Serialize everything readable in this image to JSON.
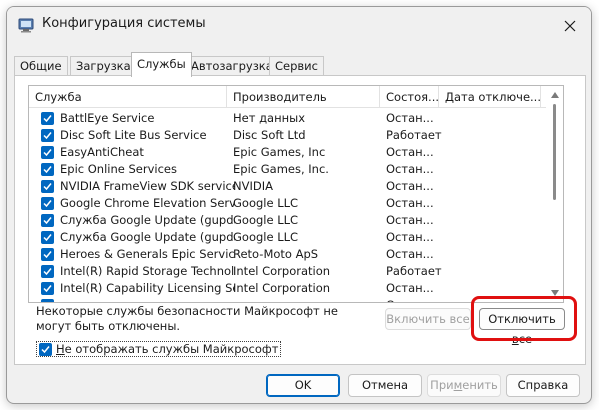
{
  "window": {
    "title": "Конфигурация системы"
  },
  "tabs": [
    {
      "label": "Общие"
    },
    {
      "label": "Загрузка"
    },
    {
      "label": "Службы",
      "active": true
    },
    {
      "label": "Автозагрузка"
    },
    {
      "label": "Сервис"
    }
  ],
  "columns": {
    "service": "Служба",
    "manufacturer": "Производитель",
    "status": "Состоя...",
    "disabled_date": "Дата отключе..."
  },
  "services": [
    {
      "name": "BattlEye Service",
      "manufacturer": "Нет данных",
      "status": "Остан...",
      "checked": true
    },
    {
      "name": "Disc Soft Lite Bus Service",
      "manufacturer": "Disc Soft Ltd",
      "status": "Работает",
      "checked": true
    },
    {
      "name": "EasyAntiCheat",
      "manufacturer": "Epic Games, Inc",
      "status": "Остан...",
      "checked": true
    },
    {
      "name": "Epic Online Services",
      "manufacturer": "Epic Games, Inc.",
      "status": "Остан...",
      "checked": true
    },
    {
      "name": "NVIDIA FrameView SDK service",
      "manufacturer": "NVIDIA",
      "status": "Остан...",
      "checked": true
    },
    {
      "name": "Google Chrome Elevation Servic...",
      "manufacturer": "Google LLC",
      "status": "Остан...",
      "checked": true
    },
    {
      "name": "Служба Google Update (gupdate)",
      "manufacturer": "Google LLC",
      "status": "Остан...",
      "checked": true
    },
    {
      "name": "Служба Google Update (gupdatem)",
      "manufacturer": "Google LLC",
      "status": "Остан...",
      "checked": true
    },
    {
      "name": "Heroes & Generals Epic Service",
      "manufacturer": "Reto-Moto ApS",
      "status": "Остан...",
      "checked": true
    },
    {
      "name": "Intel(R) Rapid Storage Technology",
      "manufacturer": "Intel Corporation",
      "status": "Работает",
      "checked": true
    },
    {
      "name": "Intel(R) Capability Licensing Ser...",
      "manufacturer": "Intel Corporation",
      "status": "Остан...",
      "checked": true
    },
    {
      "name": "",
      "manufacturer": "",
      "status": "Остан...",
      "checked": true
    }
  ],
  "notice": "Некоторые службы безопасности Майкрософт не могут быть отключены.",
  "buttons": {
    "enable_all": "Включить все",
    "disable_all_prefix": "Отключить ",
    "disable_all_underlined": "в",
    "disable_all_suffix": "се",
    "ok": "OK",
    "cancel": "Отмена",
    "apply_prefix": "При",
    "apply_underlined": "м",
    "apply_suffix": "енить",
    "help": "Справка"
  },
  "hide_ms": {
    "underlined": "Н",
    "label": "е отображать службы Майкрософт",
    "checked": true
  },
  "colors": {
    "accent": "#0067c0",
    "highlight": "#e01010"
  }
}
